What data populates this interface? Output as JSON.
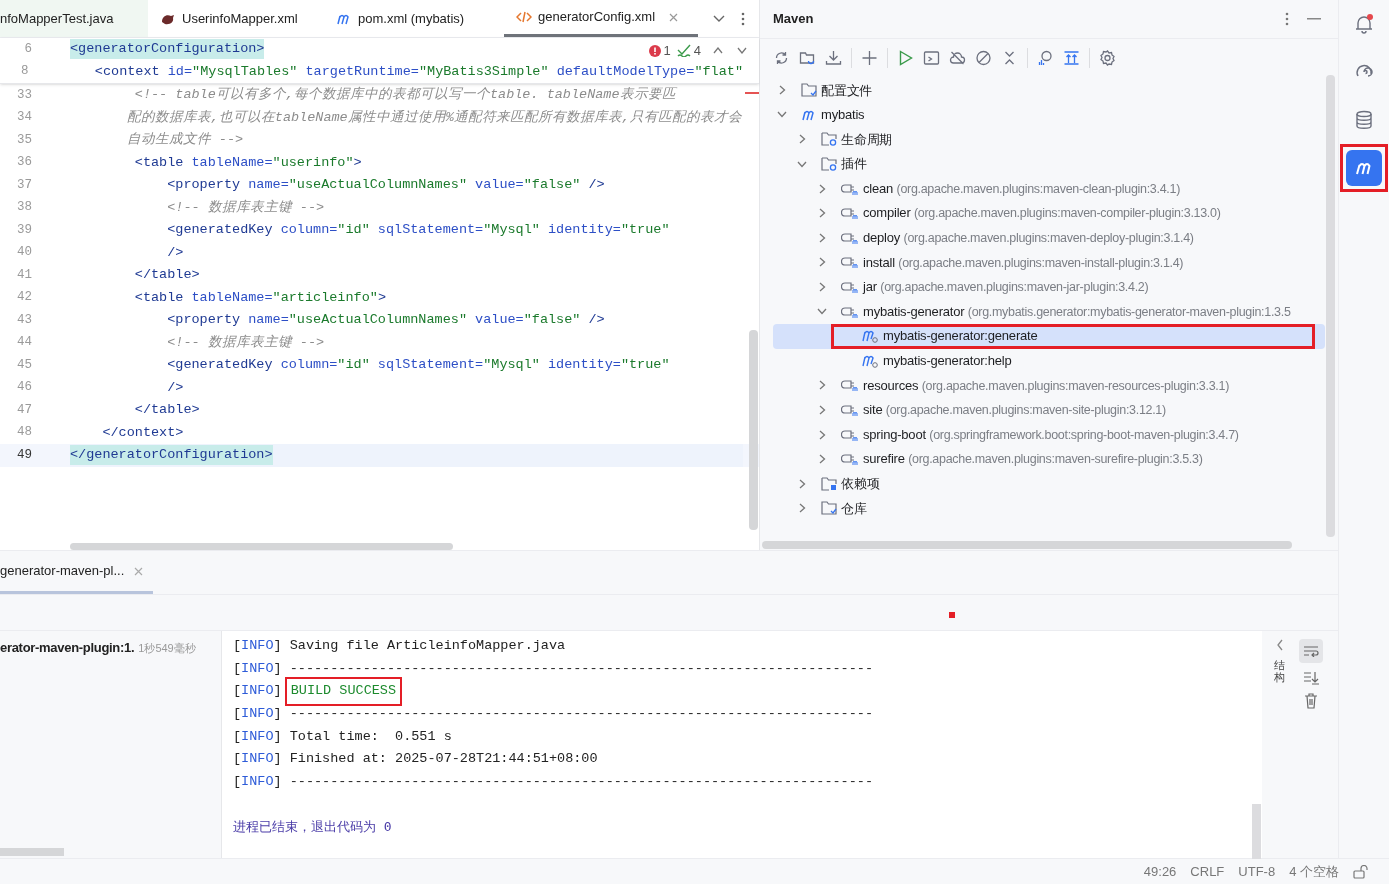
{
  "editor_tabs": [
    {
      "label": "nfoMapperTest.java",
      "kind": "java",
      "selected": false
    },
    {
      "label": "UserinfoMapper.xml",
      "kind": "mybatis",
      "selected": false
    },
    {
      "label": "pom.xml (mybatis)",
      "kind": "maven",
      "selected": false
    },
    {
      "label": "generatorConfig.xml",
      "kind": "xml",
      "selected": true
    }
  ],
  "inspections": {
    "errors": "1",
    "warnings": "4"
  },
  "sticky_lines": [
    {
      "number": "6",
      "current": false,
      "tokens": [
        {
          "kind": "matched-tag",
          "text": "<generatorConfiguration>"
        }
      ]
    },
    {
      "number": "8",
      "current": false,
      "tokens": [
        {
          "kind": "tag",
          "text": "    <context"
        },
        {
          "kind": "attr",
          "text": " id="
        },
        {
          "kind": "string",
          "text": "\"MysqlTables\""
        },
        {
          "kind": "attr",
          "text": " targetRuntime="
        },
        {
          "kind": "string",
          "text": "\"MyBatis3Simple\""
        },
        {
          "kind": "attr",
          "text": " defaultModelType="
        },
        {
          "kind": "string",
          "text": "\"flat\""
        }
      ]
    }
  ],
  "lines": [
    {
      "number": "33",
      "current": false,
      "tokens": [
        {
          "kind": "comment",
          "text": "        <!-- table可以有多个,每个数据库中的表都可以写一个table. tableName表示要匹"
        }
      ]
    },
    {
      "number": "34",
      "current": false,
      "tokens": [
        {
          "kind": "comment",
          "text": "       配的数据库表,也可以在tableName属性中通过使用%通配符来匹配所有数据库表,只有匹配的表才会"
        }
      ]
    },
    {
      "number": "35",
      "current": false,
      "tokens": [
        {
          "kind": "comment",
          "text": "       自动生成文件 -->"
        }
      ]
    },
    {
      "number": "36",
      "current": false,
      "tokens": [
        {
          "kind": "tag",
          "text": "        <table"
        },
        {
          "kind": "attr",
          "text": " tableName="
        },
        {
          "kind": "string",
          "text": "\"userinfo\""
        },
        {
          "kind": "tag",
          "text": ">"
        }
      ]
    },
    {
      "number": "37",
      "current": false,
      "tokens": [
        {
          "kind": "tag",
          "text": "            <property"
        },
        {
          "kind": "attr",
          "text": " name="
        },
        {
          "kind": "string",
          "text": "\"useActualColumnNames\""
        },
        {
          "kind": "attr",
          "text": " value="
        },
        {
          "kind": "string",
          "text": "\"false\""
        },
        {
          "kind": "tag",
          "text": " />"
        }
      ]
    },
    {
      "number": "38",
      "current": false,
      "tokens": [
        {
          "kind": "comment",
          "text": "            <!-- 数据库表主键 -->"
        }
      ]
    },
    {
      "number": "39",
      "current": false,
      "tokens": [
        {
          "kind": "tag",
          "text": "            <generatedKey"
        },
        {
          "kind": "attr",
          "text": " column="
        },
        {
          "kind": "string",
          "text": "\"id\""
        },
        {
          "kind": "attr",
          "text": " sqlStatement="
        },
        {
          "kind": "string",
          "text": "\"Mysql\""
        },
        {
          "kind": "attr",
          "text": " identity="
        },
        {
          "kind": "string",
          "text": "\"true\""
        }
      ]
    },
    {
      "number": "40",
      "current": false,
      "tokens": [
        {
          "kind": "tag",
          "text": "            />"
        }
      ]
    },
    {
      "number": "41",
      "current": false,
      "tokens": [
        {
          "kind": "tag",
          "text": "        </table>"
        }
      ]
    },
    {
      "number": "42",
      "current": false,
      "tokens": [
        {
          "kind": "tag",
          "text": "        <table"
        },
        {
          "kind": "attr",
          "text": " tableName="
        },
        {
          "kind": "string",
          "text": "\"articleinfo\""
        },
        {
          "kind": "tag",
          "text": ">"
        }
      ]
    },
    {
      "number": "43",
      "current": false,
      "tokens": [
        {
          "kind": "tag",
          "text": "            <property"
        },
        {
          "kind": "attr",
          "text": " name="
        },
        {
          "kind": "string",
          "text": "\"useActualColumnNames\""
        },
        {
          "kind": "attr",
          "text": " value="
        },
        {
          "kind": "string",
          "text": "\"false\""
        },
        {
          "kind": "tag",
          "text": " />"
        }
      ]
    },
    {
      "number": "44",
      "current": false,
      "tokens": [
        {
          "kind": "comment",
          "text": "            <!-- 数据库表主键 -->"
        }
      ]
    },
    {
      "number": "45",
      "current": false,
      "tokens": [
        {
          "kind": "tag",
          "text": "            <generatedKey"
        },
        {
          "kind": "attr",
          "text": " column="
        },
        {
          "kind": "string",
          "text": "\"id\""
        },
        {
          "kind": "attr",
          "text": " sqlStatement="
        },
        {
          "kind": "string",
          "text": "\"Mysql\""
        },
        {
          "kind": "attr",
          "text": " identity="
        },
        {
          "kind": "string",
          "text": "\"true\""
        }
      ]
    },
    {
      "number": "46",
      "current": false,
      "tokens": [
        {
          "kind": "tag",
          "text": "            />"
        }
      ]
    },
    {
      "number": "47",
      "current": false,
      "tokens": [
        {
          "kind": "tag",
          "text": "        </table>"
        }
      ]
    },
    {
      "number": "48",
      "current": false,
      "tokens": [
        {
          "kind": "tag",
          "text": "    </context>"
        }
      ]
    },
    {
      "number": "49",
      "current": true,
      "tokens": [
        {
          "kind": "matched-tag",
          "text": "</generatorConfiguration>"
        }
      ]
    }
  ],
  "maven": {
    "title": "Maven",
    "tree": [
      {
        "kind": "folder",
        "label": "配置文件",
        "expanded": false,
        "selected": false
      },
      {
        "kind": "module",
        "label": "mybatis",
        "expanded": true,
        "selected": false,
        "children": [
          {
            "kind": "gear-folder",
            "label": "生命周期",
            "expanded": false,
            "selected": false
          },
          {
            "kind": "gear-folder",
            "label": "插件",
            "expanded": true,
            "selected": false,
            "children": [
              {
                "kind": "plugin",
                "label": "clean",
                "detail": "(org.apache.maven.plugins:maven-clean-plugin:3.4.1)",
                "expanded": false,
                "selected": false
              },
              {
                "kind": "plugin",
                "label": "compiler",
                "detail": "(org.apache.maven.plugins:maven-compiler-plugin:3.13.0)",
                "expanded": false,
                "selected": false
              },
              {
                "kind": "plugin",
                "label": "deploy",
                "detail": "(org.apache.maven.plugins:maven-deploy-plugin:3.1.4)",
                "expanded": false,
                "selected": false
              },
              {
                "kind": "plugin",
                "label": "install",
                "detail": "(org.apache.maven.plugins:maven-install-plugin:3.1.4)",
                "expanded": false,
                "selected": false
              },
              {
                "kind": "plugin",
                "label": "jar",
                "detail": "(org.apache.maven.plugins:maven-jar-plugin:3.4.2)",
                "expanded": false,
                "selected": false
              },
              {
                "kind": "plugin",
                "label": "mybatis-generator",
                "detail": "(org.mybatis.generator:mybatis-generator-maven-plugin:1.3.5",
                "expanded": true,
                "selected": false,
                "children": [
                  {
                    "kind": "goal",
                    "label": "mybatis-generator:generate",
                    "selected": true,
                    "boxed": true
                  },
                  {
                    "kind": "goal",
                    "label": "mybatis-generator:help",
                    "selected": false
                  }
                ]
              },
              {
                "kind": "plugin",
                "label": "resources",
                "detail": "(org.apache.maven.plugins:maven-resources-plugin:3.3.1)",
                "expanded": false,
                "selected": false
              },
              {
                "kind": "plugin",
                "label": "site",
                "detail": "(org.apache.maven.plugins:maven-site-plugin:3.12.1)",
                "expanded": false,
                "selected": false
              },
              {
                "kind": "plugin",
                "label": "spring-boot",
                "detail": "(org.springframework.boot:spring-boot-maven-plugin:3.4.7)",
                "expanded": false,
                "selected": false
              },
              {
                "kind": "plugin",
                "label": "surefire",
                "detail": "(org.apache.maven.plugins:maven-surefire-plugin:3.5.3)",
                "expanded": false,
                "selected": false
              }
            ]
          },
          {
            "kind": "lib-folder",
            "label": "依赖项",
            "expanded": false,
            "selected": false
          },
          {
            "kind": "folder",
            "label": "仓库",
            "expanded": false,
            "selected": false
          }
        ]
      }
    ]
  },
  "tool_strip": [
    {
      "kind": "bell",
      "badge": true,
      "selected": false
    },
    {
      "kind": "swirl",
      "selected": false
    },
    {
      "kind": "database",
      "selected": false
    },
    {
      "kind": "maven",
      "selected": true,
      "boxed": true
    }
  ],
  "run": {
    "tab": {
      "label": "generator-maven-pl...",
      "selected": true
    },
    "task": {
      "label": "erator-maven-plugin:1.",
      "time": "1秒549毫秒"
    },
    "console": [
      {
        "tokens": [
          {
            "kind": "plain",
            "text": "["
          },
          {
            "kind": "level",
            "text": "INFO"
          },
          {
            "kind": "plain",
            "text": "] Saving file ArticleinfoMapper.java"
          }
        ]
      },
      {
        "tokens": [
          {
            "kind": "plain",
            "text": "["
          },
          {
            "kind": "level",
            "text": "INFO"
          },
          {
            "kind": "plain",
            "text": "] ------------------------------------------------------------------------"
          }
        ]
      },
      {
        "tokens": [
          {
            "kind": "plain",
            "text": "["
          },
          {
            "kind": "level",
            "text": "INFO"
          },
          {
            "kind": "plain",
            "text": "] "
          },
          {
            "kind": "success",
            "text": "BUILD SUCCESS",
            "boxed": true
          }
        ]
      },
      {
        "tokens": [
          {
            "kind": "plain",
            "text": "["
          },
          {
            "kind": "level",
            "text": "INFO"
          },
          {
            "kind": "plain",
            "text": "] ------------------------------------------------------------------------"
          }
        ]
      },
      {
        "tokens": [
          {
            "kind": "plain",
            "text": "["
          },
          {
            "kind": "level",
            "text": "INFO"
          },
          {
            "kind": "plain",
            "text": "] Total time:  0.551 s"
          }
        ]
      },
      {
        "tokens": [
          {
            "kind": "plain",
            "text": "["
          },
          {
            "kind": "level",
            "text": "INFO"
          },
          {
            "kind": "plain",
            "text": "] Finished at: 2025-07-28T21:44:51+08:00"
          }
        ]
      },
      {
        "tokens": [
          {
            "kind": "plain",
            "text": "["
          },
          {
            "kind": "level",
            "text": "INFO"
          },
          {
            "kind": "plain",
            "text": "] ------------------------------------------------------------------------"
          }
        ]
      }
    ],
    "exit_message": "进程已结束，退出代码为 0",
    "side_label": "结构"
  },
  "status_bar": [
    "49:26",
    "CRLF",
    "UTF-8",
    "4 个空格"
  ]
}
